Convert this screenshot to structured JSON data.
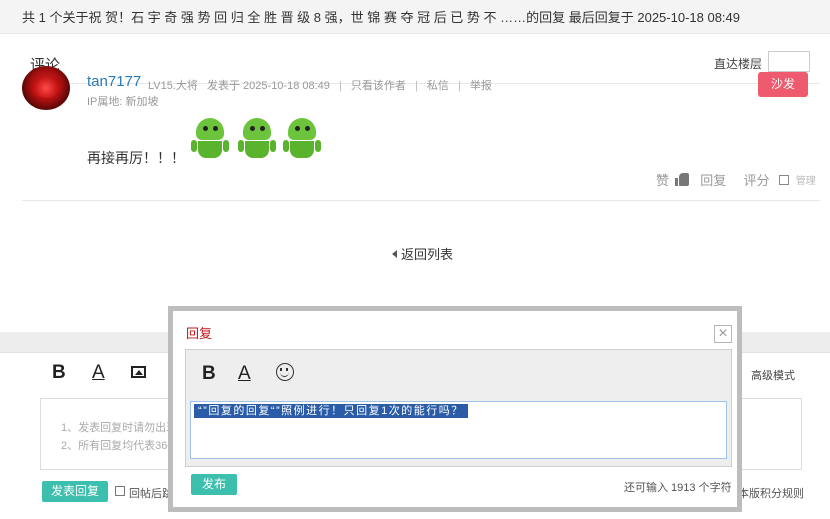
{
  "topbar": {
    "text": "共 1 个关于祝 贺！石 宇 奇 强 势 回 归 全 胜 晋 级 8 强，世 锦 赛 夺 冠 后 已 势 不 ……的回复 最后回复于 2025-10-18 08:49"
  },
  "comments": {
    "title": "评论",
    "goto_label": "直达楼层",
    "goto_value": ""
  },
  "post": {
    "username": "tan7177",
    "level": "LV15.大将",
    "posted_at": "发表于 2025-10-18 08:49",
    "only_author": "只看该作者",
    "private_msg": "私信",
    "report": "举报",
    "ip": "IP属地: 新加坡",
    "sofa": "沙发",
    "text": "再接再厉！！！",
    "emoji": "android-emoji",
    "like_label": "赞",
    "reply_label": "回复",
    "rate_label": "评分",
    "manage_label": "管理"
  },
  "back_to_list": "返回列表",
  "editor": {
    "advanced_mode": "高级模式",
    "rules": [
      "1、发表回复时请勿出现",
      "2、所有回复均代表360"
    ],
    "submit": "发表回复",
    "checkbox_label": "回帖后跳",
    "rules_link": "本版积分规则"
  },
  "dialog": {
    "title": "回复",
    "close": "×",
    "textarea_selected": "“”回复的回复“”照例进行！只回复1次的能行吗？",
    "publish": "发布",
    "remaining": "还可输入 1913 个字符"
  },
  "colors": {
    "accent_red": "#c0151d",
    "sofa_pink": "#ef5b6e",
    "teal_button": "#3dbfae",
    "username_blue": "#2a7ab8",
    "selection_blue": "#2a5ca8"
  }
}
